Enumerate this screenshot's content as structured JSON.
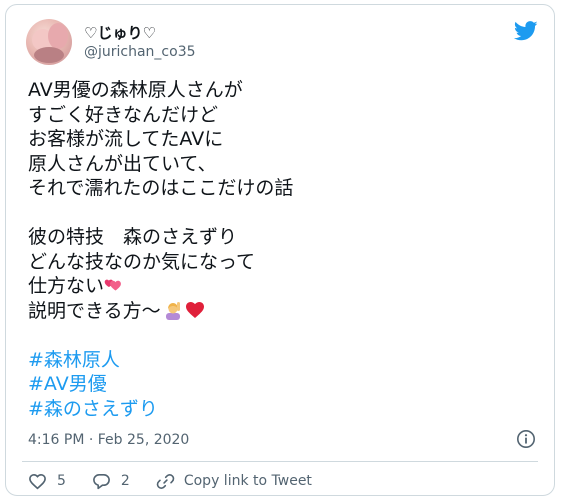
{
  "user": {
    "display_name": "♡じゅり♡",
    "handle": "@jurichan_co35"
  },
  "tweet": {
    "lines": [
      "AV男優の森林原人さんが",
      "すごく好きなんだけど",
      "お客様が流してたAVに",
      "原人さんが出ていて、",
      "それで濡れたのはここだけの話"
    ],
    "lines2": [
      "彼の特技　森のさえずり",
      "どんな技なのか気になって"
    ],
    "line_with_heart": "仕方ない",
    "line_with_emojis": "説明できる方〜",
    "hashtags": [
      "#森林原人",
      "#AV男優",
      "#森のさえずり"
    ],
    "emojis": [
      "two-hearts-emoji",
      "person-raising-hand-emoji",
      "red-heart-emoji"
    ]
  },
  "meta": {
    "timestamp": "4:16 PM · Feb 25, 2020"
  },
  "actions": {
    "likes": "5",
    "replies": "2",
    "copy_link": "Copy link to Tweet"
  },
  "colors": {
    "accent": "#1d9bf0",
    "text": "#0f1419",
    "muted": "#536471",
    "border": "#cfd9de",
    "heart": "#f91880"
  }
}
